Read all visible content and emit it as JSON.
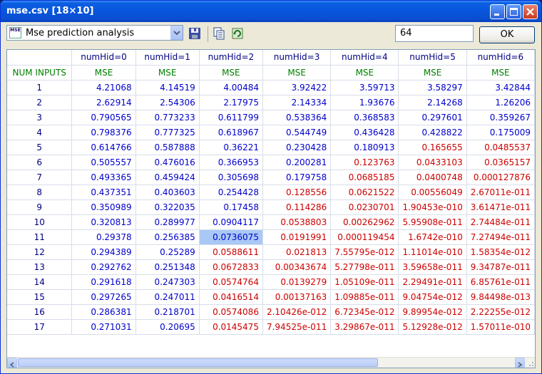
{
  "window": {
    "title": "mse.csv [18×10]"
  },
  "toolbar": {
    "combo_icon_text": "MSE",
    "combo_value": "Mse prediction analysis",
    "number_value": "64",
    "ok_label": "OK"
  },
  "table": {
    "columns": [
      "numHid=0",
      "numHid=1",
      "numHid=2",
      "numHid=3",
      "numHid=4",
      "numHid=5",
      "numHid=6"
    ],
    "row_header_label": "NUM INPUTS",
    "sub_header": "MSE",
    "rows": [
      {
        "n": "1",
        "cells": [
          "4.21068",
          "4.14519",
          "4.00484",
          "3.92422",
          "3.59713",
          "3.58297",
          "3.42844"
        ]
      },
      {
        "n": "2",
        "cells": [
          "2.62914",
          "2.54306",
          "2.17975",
          "2.14334",
          "1.93676",
          "2.14268",
          "1.26206"
        ]
      },
      {
        "n": "3",
        "cells": [
          "0.790565",
          "0.773233",
          "0.611799",
          "0.538364",
          "0.368583",
          "0.297601",
          "0.359267"
        ]
      },
      {
        "n": "4",
        "cells": [
          "0.798376",
          "0.777325",
          "0.618967",
          "0.544749",
          "0.436428",
          "0.428822",
          "0.175009"
        ]
      },
      {
        "n": "5",
        "cells": [
          "0.614766",
          "0.587888",
          "0.36221",
          "0.230428",
          "0.180913",
          "0.165655",
          "0.0485537"
        ]
      },
      {
        "n": "6",
        "cells": [
          "0.505557",
          "0.476016",
          "0.366953",
          "0.200281",
          "0.123763",
          "0.0433103",
          "0.0365157"
        ]
      },
      {
        "n": "7",
        "cells": [
          "0.493365",
          "0.459424",
          "0.305698",
          "0.179758",
          "0.0685185",
          "0.0400748",
          "0.000127876"
        ]
      },
      {
        "n": "8",
        "cells": [
          "0.437351",
          "0.403603",
          "0.254428",
          "0.128556",
          "0.0621522",
          "0.00556049",
          "2.67011e-011"
        ]
      },
      {
        "n": "9",
        "cells": [
          "0.350989",
          "0.322035",
          "0.17458",
          "0.114286",
          "0.0230701",
          "1.90453e-010",
          "3.61471e-011"
        ]
      },
      {
        "n": "10",
        "cells": [
          "0.320813",
          "0.289977",
          "0.0904117",
          "0.0538803",
          "0.00262962",
          "5.95908e-011",
          "2.74484e-011"
        ]
      },
      {
        "n": "11",
        "cells": [
          "0.29378",
          "0.256385",
          "0.0736075",
          "0.0191991",
          "0.000119454",
          "1.6742e-010",
          "7.27494e-011"
        ]
      },
      {
        "n": "12",
        "cells": [
          "0.294389",
          "0.25289",
          "0.0588611",
          "0.021813",
          "7.55795e-012",
          "1.11014e-010",
          "1.58354e-012"
        ]
      },
      {
        "n": "13",
        "cells": [
          "0.292762",
          "0.251348",
          "0.0672833",
          "0.00343674",
          "5.27798e-011",
          "3.59658e-011",
          "9.34787e-011"
        ]
      },
      {
        "n": "14",
        "cells": [
          "0.291618",
          "0.247303",
          "0.0574764",
          "0.0139279",
          "1.05109e-011",
          "2.29491e-011",
          "6.85761e-011"
        ]
      },
      {
        "n": "15",
        "cells": [
          "0.297265",
          "0.247011",
          "0.0416514",
          "0.00137163",
          "1.09885e-011",
          "9.04754e-012",
          "9.84498e-013"
        ]
      },
      {
        "n": "16",
        "cells": [
          "0.286381",
          "0.218701",
          "0.0574086",
          "2.10426e-012",
          "6.72345e-012",
          "9.89954e-012",
          "2.22255e-012"
        ]
      },
      {
        "n": "17",
        "cells": [
          "0.271031",
          "0.20695",
          "0.0145475",
          "7.94525e-011",
          "3.29867e-011",
          "5.12928e-012",
          "1.57011e-010"
        ]
      }
    ],
    "red_cells": [
      [
        5,
        5
      ],
      [
        5,
        6
      ],
      [
        6,
        4
      ],
      [
        6,
        5
      ],
      [
        6,
        6
      ],
      [
        7,
        4
      ],
      [
        7,
        5
      ],
      [
        7,
        6
      ],
      [
        8,
        3
      ],
      [
        8,
        4
      ],
      [
        8,
        5
      ],
      [
        8,
        6
      ],
      [
        9,
        3
      ],
      [
        9,
        4
      ],
      [
        9,
        5
      ],
      [
        9,
        6
      ],
      [
        10,
        3
      ],
      [
        10,
        4
      ],
      [
        10,
        5
      ],
      [
        10,
        6
      ],
      [
        11,
        3
      ],
      [
        11,
        4
      ],
      [
        11,
        5
      ],
      [
        11,
        6
      ],
      [
        12,
        2
      ],
      [
        12,
        3
      ],
      [
        12,
        4
      ],
      [
        12,
        5
      ],
      [
        12,
        6
      ],
      [
        13,
        2
      ],
      [
        13,
        3
      ],
      [
        13,
        4
      ],
      [
        13,
        5
      ],
      [
        13,
        6
      ],
      [
        14,
        2
      ],
      [
        14,
        3
      ],
      [
        14,
        4
      ],
      [
        14,
        5
      ],
      [
        14,
        6
      ],
      [
        15,
        2
      ],
      [
        15,
        3
      ],
      [
        15,
        4
      ],
      [
        15,
        5
      ],
      [
        15,
        6
      ],
      [
        16,
        2
      ],
      [
        16,
        3
      ],
      [
        16,
        4
      ],
      [
        16,
        5
      ],
      [
        16,
        6
      ],
      [
        17,
        2
      ],
      [
        17,
        3
      ],
      [
        17,
        4
      ],
      [
        17,
        5
      ],
      [
        17,
        6
      ]
    ],
    "selected_cell": [
      11,
      2
    ],
    "colors": {
      "low": "#cc0000",
      "normal": "#0000cc",
      "header": "#000080",
      "mse_header": "#008000",
      "selection": "#a9c8f5"
    }
  }
}
